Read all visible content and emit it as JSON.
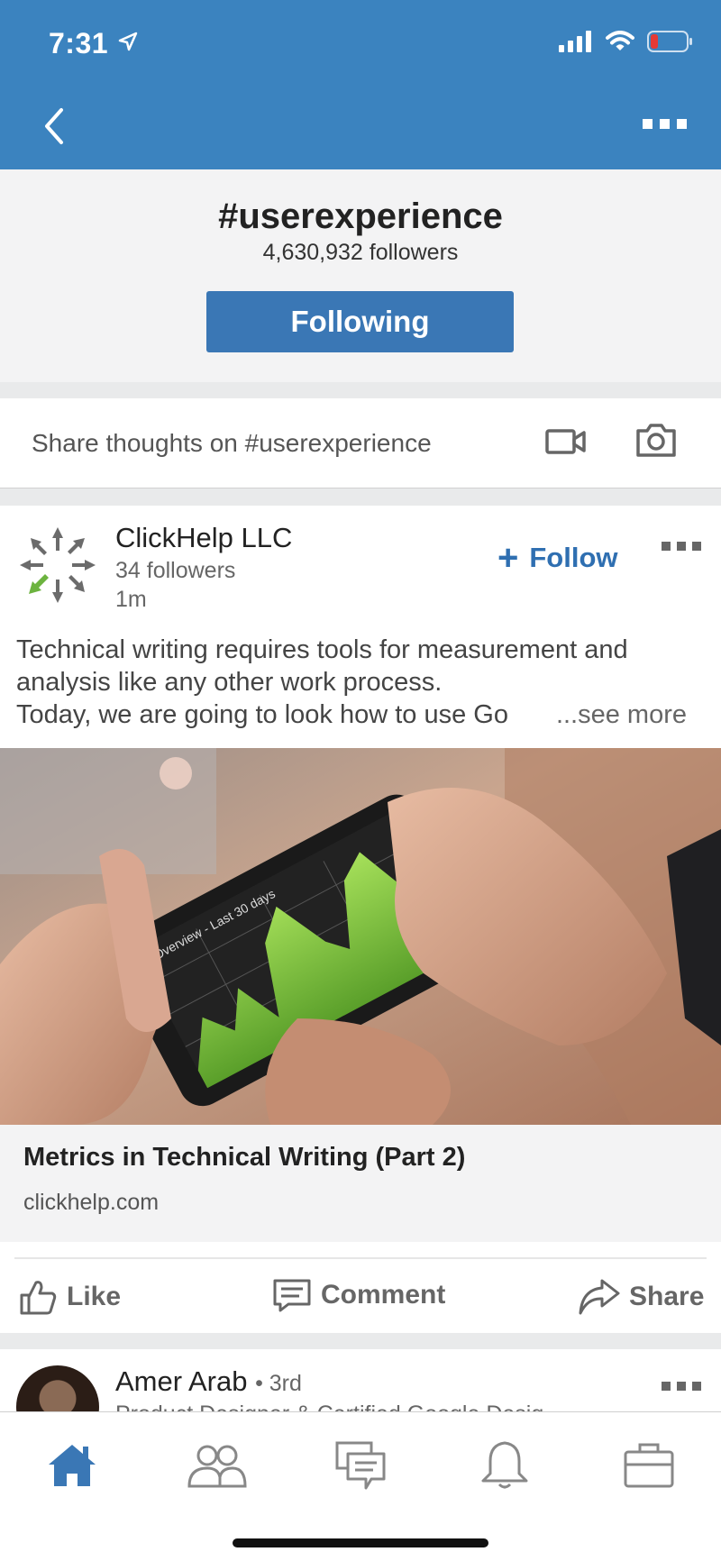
{
  "status_bar": {
    "time": "7:31"
  },
  "hashtag": {
    "title": "#userexperience",
    "followers": "4,630,932 followers",
    "following_label": "Following"
  },
  "share": {
    "placeholder": "Share thoughts on #userexperience"
  },
  "post": {
    "author": "ClickHelp LLC",
    "followers": "34 followers",
    "time": "1m",
    "follow_label": "Follow",
    "text_lines": [
      "Technical writing requires tools for measurement and",
      "analysis like any other work process.",
      "Today, we are going to look how to use Go"
    ],
    "see_more": "...see more",
    "image_caption_text": "Overview - Last 30 days",
    "link_title": "Metrics in Technical Writing (Part 2)",
    "link_domain": "clickhelp.com",
    "actions": {
      "like": "Like",
      "comment": "Comment",
      "share": "Share"
    }
  },
  "next_post": {
    "author": "Amer Arab",
    "degree": "• 3rd",
    "headline": "Product Designer & Certified Google Desig"
  },
  "colors": {
    "brand_blue": "#3b83bf",
    "button_blue": "#3a77b5",
    "link_blue": "#2f6fb1"
  }
}
